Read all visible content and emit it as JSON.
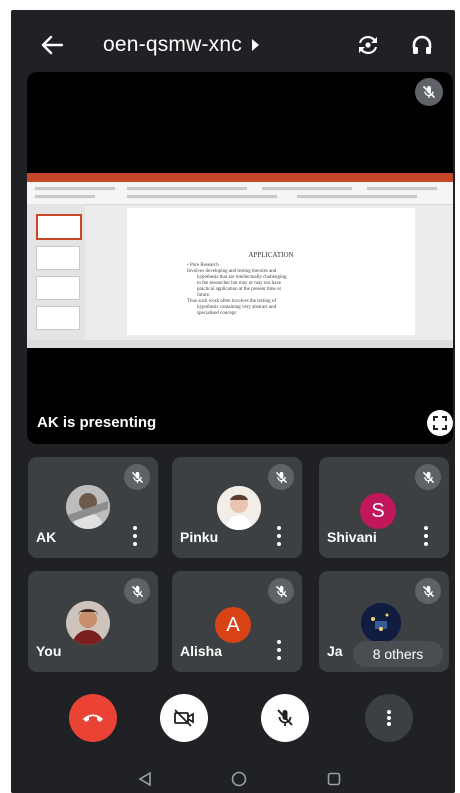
{
  "topbar": {
    "meeting_code": "oen-qsmw-xnc"
  },
  "presentation": {
    "presenter_text": "AK is presenting",
    "slide": {
      "title": "APPLICATION",
      "lines": [
        "•  Pure Research",
        "Involves developing and testing theories and",
        "hypothesis that are intellectually challenging",
        "to the researcher but may or may not have",
        "practical application at the present time or",
        "future.",
        "Thus such work often involves the testing of",
        "hypothesis containing very abstract and",
        "specialised concept."
      ]
    }
  },
  "participants": [
    {
      "name": "AK",
      "avatar_type": "photo",
      "initial": "",
      "muted": true
    },
    {
      "name": "Pinku",
      "avatar_type": "photo",
      "initial": "",
      "muted": true
    },
    {
      "name": "Shivani",
      "avatar_type": "initial",
      "initial": "S",
      "color": "#c2185b",
      "muted": true
    },
    {
      "name": "You",
      "avatar_type": "photo",
      "initial": "",
      "muted": true
    },
    {
      "name": "Alisha",
      "avatar_type": "initial",
      "initial": "A",
      "color": "#d84315",
      "muted": true
    },
    {
      "name": "Ja",
      "avatar_type": "photo",
      "initial": "",
      "muted": true,
      "overflow_label": "8 others"
    }
  ],
  "controls": {
    "end_call_color": "#ea4335",
    "button_light": "#ffffff",
    "button_dark": "#3c4043"
  },
  "icons": [
    "back-arrow-icon",
    "switch-camera-icon",
    "headphones-icon",
    "mic-off-icon",
    "fullscreen-icon",
    "more-vert-icon",
    "end-call-icon",
    "camera-off-icon",
    "nav-back-icon",
    "nav-home-icon",
    "nav-recents-icon"
  ]
}
